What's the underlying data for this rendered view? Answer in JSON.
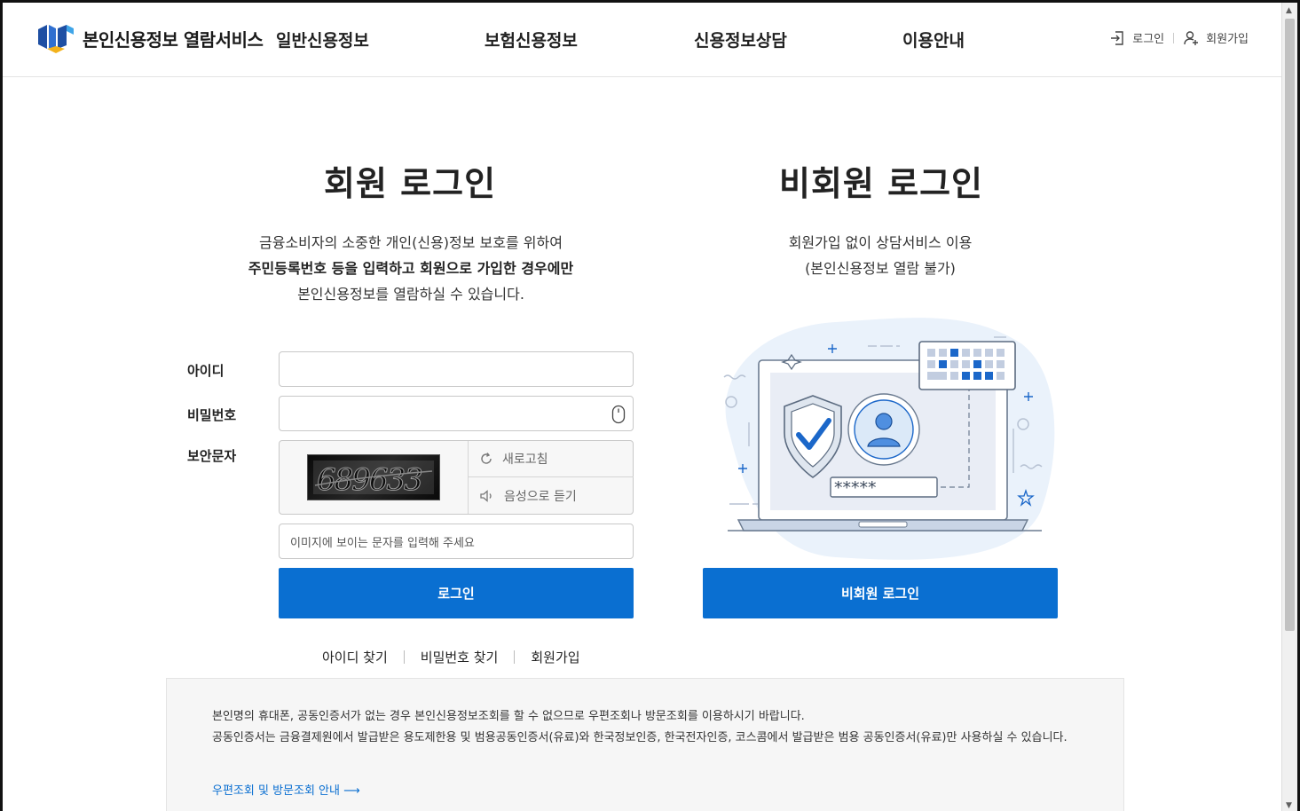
{
  "header": {
    "logo_text": "본인신용정보 열람서비스",
    "nav": [
      "일반신용정보",
      "보험신용정보",
      "신용정보상담",
      "이용안내"
    ],
    "util": {
      "login": "로그인",
      "signup": "회원가입"
    }
  },
  "member": {
    "title": "회원 로그인",
    "desc_line1": "금융소비자의 소중한 개인(신용)정보 보호를 위하여",
    "desc_line2": "주민등록번호 등을 입력하고 회원으로 가입한 경우에만",
    "desc_line3": "본인신용정보를 열람하실 수 있습니다.",
    "id_label": "아이디",
    "pw_label": "비밀번호",
    "captcha_label": "보안문자",
    "captcha_text": "689633",
    "refresh_label": "새로고침",
    "audio_label": "음성으로 듣기",
    "captcha_placeholder": "이미지에 보이는 문자를 입력해 주세요",
    "login_button": "로그인",
    "links": [
      "아이디 찾기",
      "비밀번호 찾기",
      "회원가입"
    ]
  },
  "guest": {
    "title": "비회원 로그인",
    "desc_line1": "회원가입 없이 상담서비스 이용",
    "desc_line2": "(본인신용정보 열람 불가)",
    "password_mask": "*****",
    "login_button": "비회원 로그인"
  },
  "notice": {
    "line1": "본인명의 휴대폰, 공동인증서가 없는 경우 본인신용정보조회를 할 수 없으므로 우편조회나 방문조회를 이용하시기 바랍니다.",
    "line2": "공동인증서는 금융결제원에서 발급받은 용도제한용 및 범용공동인증서(유료)와 한국정보인증, 한국전자인증, 코스콤에서 발급받은 범용 공동인증서(유료)만 사용하실 수 있습니다.",
    "link": "우편조회 및 방문조회 안내 ⟶"
  },
  "colors": {
    "primary": "#0a6fd1",
    "accent_light": "#e8f0fb"
  }
}
